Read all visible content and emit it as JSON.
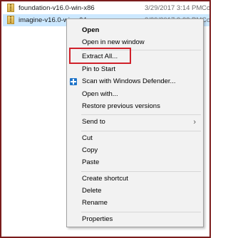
{
  "files": [
    {
      "name": "foundation-v16.0-win-x86",
      "date": "3/29/2017 3:14 PM",
      "type": "Co",
      "selected": false
    },
    {
      "name": "imagine-v16.0-win-x64",
      "date": "3/29/2017 3:22 PM",
      "type": "Co",
      "selected": true
    }
  ],
  "menu": {
    "open": "Open",
    "open_new_window": "Open in new window",
    "extract_all": "Extract All...",
    "pin_to_start": "Pin to Start",
    "scan_defender": "Scan with Windows Defender...",
    "open_with": "Open with...",
    "restore_versions": "Restore previous versions",
    "send_to": "Send to",
    "send_to_arrow": "›",
    "cut": "Cut",
    "copy": "Copy",
    "paste": "Paste",
    "create_shortcut": "Create shortcut",
    "delete": "Delete",
    "rename": "Rename",
    "properties": "Properties"
  },
  "colors": {
    "frame": "#7a1c1c",
    "highlight": "#d0202a",
    "selection": "#cce8ff",
    "menu_bg": "#f2f2f2"
  }
}
